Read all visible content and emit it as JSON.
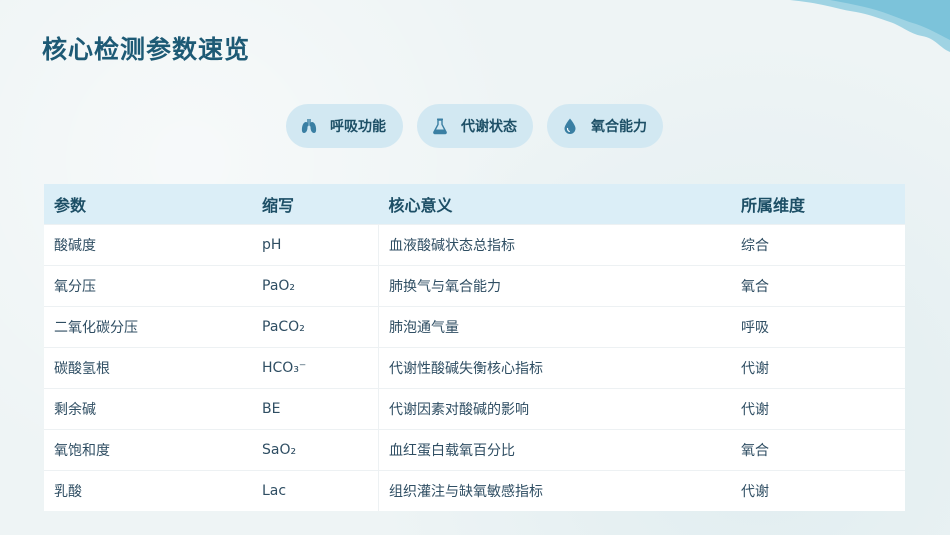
{
  "title": "核心检测参数速览",
  "categories": [
    {
      "label": "呼吸功能",
      "icon": "lungs-icon"
    },
    {
      "label": "代谢状态",
      "icon": "flask-icon"
    },
    {
      "label": "氧合能力",
      "icon": "droplet-icon"
    }
  ],
  "table": {
    "headers": [
      "参数",
      "缩写",
      "核心意义",
      "所属维度"
    ],
    "rows": [
      [
        "酸碱度",
        "pH",
        "血液酸碱状态总指标",
        "综合"
      ],
      [
        "氧分压",
        "PaO₂",
        "肺换气与氧合能力",
        "氧合"
      ],
      [
        "二氧化碳分压",
        "PaCO₂",
        "肺泡通气量",
        "呼吸"
      ],
      [
        "碳酸氢根",
        "HCO₃⁻",
        "代谢性酸碱失衡核心指标",
        "代谢"
      ],
      [
        "剩余碱",
        "BE",
        "代谢因素对酸碱的影响",
        "代谢"
      ],
      [
        "氧饱和度",
        "SaO₂",
        "血红蛋白载氧百分比",
        "氧合"
      ],
      [
        "乳酸",
        "Lac",
        "组织灌注与缺氧敏感指标",
        "代谢"
      ]
    ]
  },
  "colors": {
    "accent": "#1d5a75",
    "pill_bg": "#d2e8f2",
    "header_bg": "#dbeef7"
  }
}
